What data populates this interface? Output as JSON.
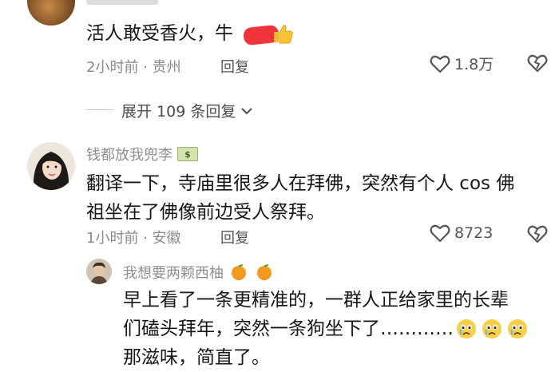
{
  "comments": [
    {
      "text_prefix": "活人敢受香火，牛",
      "time_location": "2小时前 · 贵州",
      "reply_label": "回复",
      "likes": "1.8万",
      "expand_label": "展开 109 条回复"
    },
    {
      "username": "钱都放我兜李",
      "badge": "$",
      "text_line1": "翻译一下，寺庙里很多人在拜佛，突然有个人 cos 佛",
      "text_line2": "祖坐在了佛像前边受人祭拜。",
      "time_location": "1小时前 · 安徽",
      "reply_label": "回复",
      "likes": "8723"
    },
    {
      "username": "我想要两颗西柚",
      "text_line1": "早上看了一条更精准的，一群人正给家里的长辈",
      "text_line2": "们磕头拜年，突然一条狗坐下了…………",
      "text_line3": "那滋味，简直了。"
    }
  ],
  "icons": {
    "heart": "heart-icon",
    "dislike": "dislike-heart-icon",
    "thumb": "thumbs-up-emoji",
    "orange": "orange-emoji",
    "tear_face": "tearful-face-emoji"
  },
  "colors": {
    "redaction": "#f0343c",
    "orange": "#f39a1e",
    "meta_gray": "#8a8a8a"
  }
}
